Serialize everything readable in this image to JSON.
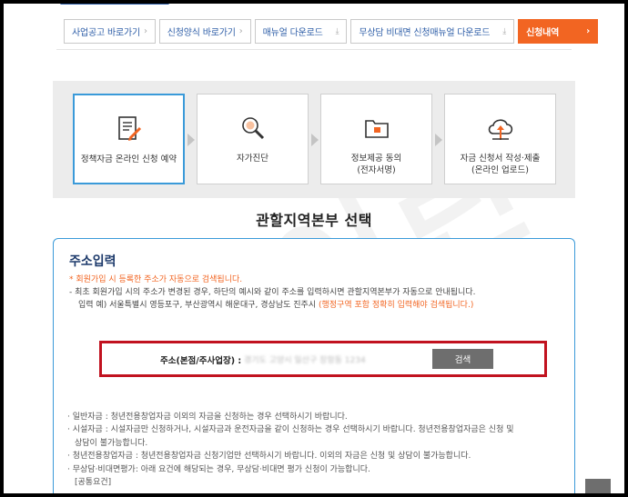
{
  "nav": {
    "items": [
      {
        "label": "사업공고 바로가기",
        "suffix": "›"
      },
      {
        "label": "신청양식 바로가기",
        "suffix": "›"
      },
      {
        "label": "매뉴얼 다운로드",
        "suffix": "⤓"
      },
      {
        "label": "무상담 비대면 신청매뉴얼 다운로드",
        "suffix": "⤓"
      },
      {
        "label": "신청내역",
        "suffix": "›"
      }
    ]
  },
  "steps": [
    {
      "label": "정책자금 온라인 신청 예약",
      "icon": "document-pen-icon",
      "active": true
    },
    {
      "label": "자가진단",
      "icon": "magnifier-icon",
      "active": false
    },
    {
      "label": "정보제공 동의\n(전자서명)",
      "icon": "folder-icon",
      "active": false
    },
    {
      "label": "자금 신청서 작성·제출\n(온라인 업로드)",
      "icon": "cloud-upload-icon",
      "active": false
    }
  ],
  "section_title": "관할지역본부 선택",
  "panel": {
    "title": "주소입력",
    "notice_1": "* 회원가입 시 등록한 주소가 자동으로 검색됩니다.",
    "notice_2": "- 최초 회원가입 시의 주소가 변경된 경우, 하단의 예시와 같이 주소를 입력하시면 관할지역본부가 자동으로 안내됩니다.",
    "notice_3_a": "입력 예) 서울특별시 영등포구, 부산광역시 해운대구, 경상남도 진주시 ",
    "notice_3_b": "(행정구역 포함 정확히 입력해야 검색됩니다.)",
    "search_label": "주소(본점/주사업장) :",
    "search_value": "경기도 고양시 일산구 장항동 1234",
    "search_button": "검색",
    "info_lines": [
      "· 일반자금 : 청년전용창업자금 이외의 자금을 신청하는 경우 선택하시기 바랍니다.",
      "· 시설자금 : 시설자금만 신청하거나, 시설자금과 운전자금을 같이 신청하는 경우 선택하시기 바랍니다. 청년전용창업자금은 신청 및",
      "  상담이 불가능합니다.",
      "· 청년전용창업자금 : 청년전용창업자금 신청기업만 선택하시기 바랍니다. 이외의 자금은 신청 및 상담이 불가능합니다.",
      "· 무상담·비대면평가: 아래 요건에 해당되는 경우, 무상담·비대면 평가 신청이 가능합니다.",
      "  [공통요건]"
    ]
  },
  "colors": {
    "accent": "#f26522",
    "primary": "#2f5fa8",
    "highlight_border": "#c1121f",
    "step_active": "#3a9ad9"
  }
}
